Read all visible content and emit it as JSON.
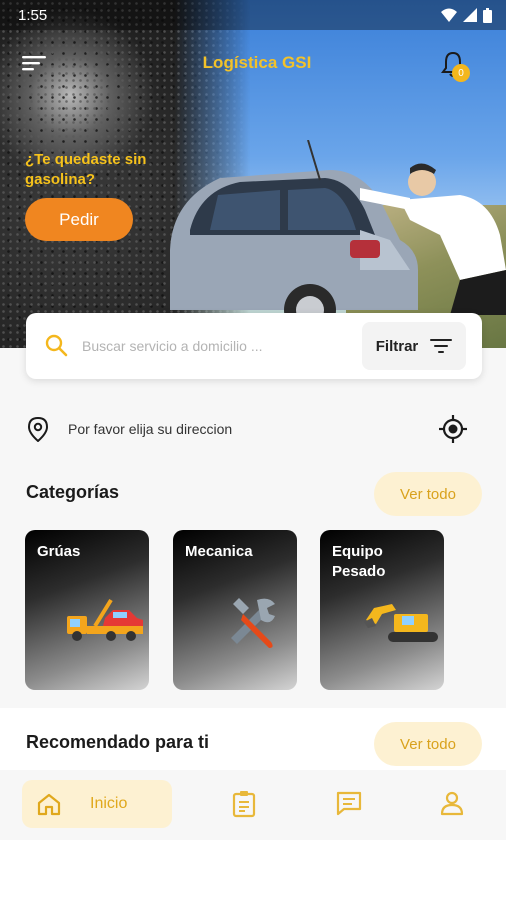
{
  "status_bar": {
    "time": "1:55"
  },
  "header": {
    "title": "Logística GSI",
    "notification_count": "0"
  },
  "promo": {
    "text": "¿Te quedaste sin gasolina?",
    "button_label": "Pedir"
  },
  "search": {
    "placeholder": "Buscar servicio a domicilio ...",
    "filter_label": "Filtrar"
  },
  "address": {
    "text": "Por favor elija su direccion"
  },
  "categories": {
    "title": "Categorías",
    "see_all": "Ver todo",
    "items": [
      {
        "label": "Grúas",
        "icon": "tow-truck-icon"
      },
      {
        "label": "Mecanica",
        "icon": "tools-icon"
      },
      {
        "label": "Equipo Pesado",
        "icon": "excavator-icon"
      }
    ]
  },
  "recommended": {
    "title": "Recomendado para ti",
    "see_all": "Ver todo"
  },
  "bottom_nav": {
    "items": [
      {
        "label": "Inicio",
        "icon": "home-icon",
        "active": true
      },
      {
        "label": "",
        "icon": "orders-icon"
      },
      {
        "label": "",
        "icon": "chat-icon"
      },
      {
        "label": "",
        "icon": "profile-icon"
      }
    ]
  },
  "colors": {
    "accent": "#f4b71d",
    "order_button": "#f08620",
    "title": "#f2c22a",
    "pill_bg": "#fdf1d2"
  }
}
